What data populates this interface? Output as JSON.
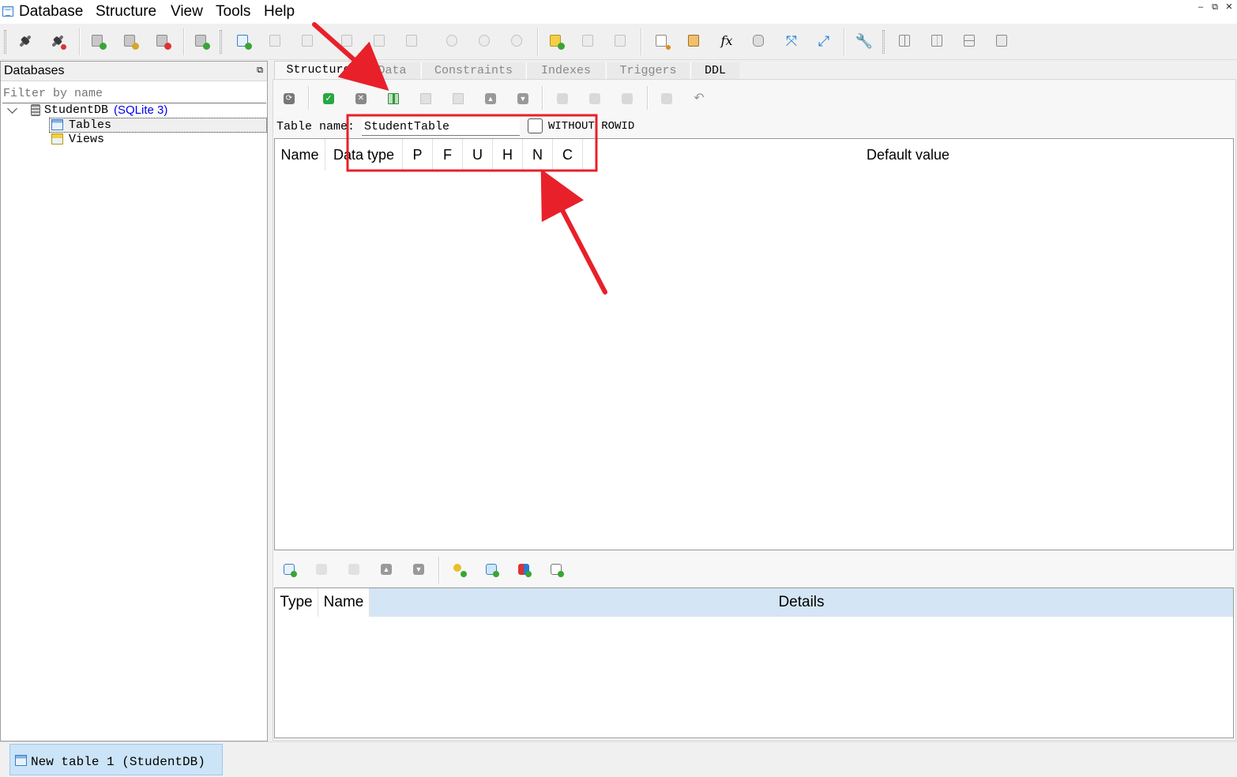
{
  "menubar": {
    "items": [
      "Database",
      "Structure",
      "View",
      "Tools",
      "Help"
    ],
    "window_controls": [
      "–",
      "⧉",
      "✕"
    ]
  },
  "databases_panel": {
    "title": "Databases",
    "filter_placeholder": "Filter by name",
    "tree": {
      "db_name": "StudentDB",
      "db_engine": "(SQLite 3)",
      "children": [
        "Tables",
        "Views"
      ]
    }
  },
  "tabs": [
    "Structure",
    "Data",
    "Constraints",
    "Indexes",
    "Triggers",
    "DDL"
  ],
  "table_editor": {
    "table_name_label": "Table name:",
    "table_name_value": "StudentTable",
    "without_rowid_label": "WITHOUT ROWID",
    "columns_headers": [
      "Name",
      "Data type",
      "P",
      "F",
      "U",
      "H",
      "N",
      "C",
      "Default value"
    ],
    "constraints_headers": [
      "Type",
      "Name",
      "Details"
    ]
  },
  "statusbar": {
    "task_label": "New table 1 (StudentDB)"
  },
  "colors": {
    "annotation_red": "#e8202a",
    "engine_link": "#0000ee",
    "selection_blue": "#cce4f7",
    "header_blue": "#d4e6f5"
  }
}
